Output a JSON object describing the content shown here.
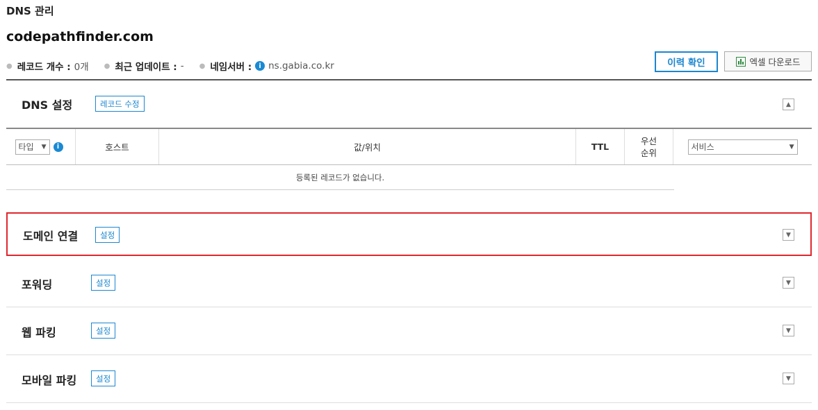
{
  "page": {
    "label": "DNS 관리",
    "domain": "codepathfinder.com"
  },
  "meta": {
    "record_count_key": "레코드 개수 :",
    "record_count_val": "0개",
    "updated_key": "최근 업데이트 :",
    "updated_val": "-",
    "ns_key": "네임서버 :",
    "ns_val": "ns.gabia.co.kr"
  },
  "actions": {
    "history": "이력 확인",
    "excel": "엑셀 다운로드"
  },
  "dns": {
    "title": "DNS 설정",
    "edit_button": "레코드 수정",
    "columns": {
      "type_select": "타입",
      "host": "호스트",
      "value": "값/위치",
      "ttl": "TTL",
      "priority_1": "우선",
      "priority_2": "순위",
      "service_select": "서비스"
    },
    "empty": "등록된 레코드가 없습니다."
  },
  "sections": [
    {
      "title": "도메인 연결",
      "button": "설정"
    },
    {
      "title": "포워딩",
      "button": "설정"
    },
    {
      "title": "웹 파킹",
      "button": "설정"
    },
    {
      "title": "모바일 파킹",
      "button": "설정"
    }
  ],
  "colors": {
    "accent": "#1a86d0",
    "highlight": "#e0262d"
  }
}
